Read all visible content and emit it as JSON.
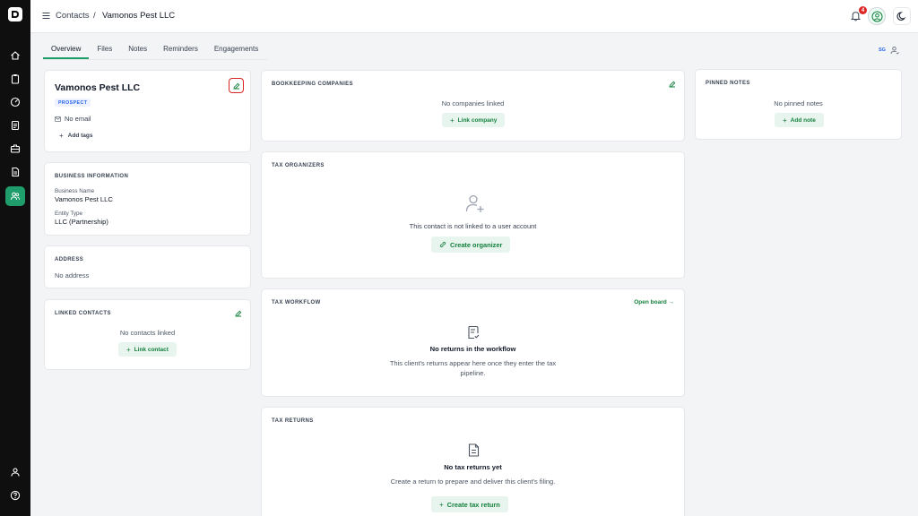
{
  "breadcrumb": {
    "parent": "Contacts",
    "separator": "/",
    "current": "Vamonos Pest LLC"
  },
  "notifications": {
    "count": "4"
  },
  "tabs": [
    {
      "label": "Overview",
      "active": true
    },
    {
      "label": "Files",
      "active": false
    },
    {
      "label": "Notes",
      "active": false
    },
    {
      "label": "Reminders",
      "active": false
    },
    {
      "label": "Engagements",
      "active": false
    }
  ],
  "presence": {
    "initials": "SG"
  },
  "contact": {
    "name": "Vamonos Pest LLC",
    "status": "PROSPECT",
    "email": "No email",
    "add_tags": "Add tags"
  },
  "business_info": {
    "title": "BUSINESS INFORMATION",
    "business_name_label": "Business Name",
    "business_name": "Vamonos Pest LLC",
    "entity_type_label": "Entity Type",
    "entity_type": "LLC (Partnership)"
  },
  "address": {
    "title": "ADDRESS",
    "value": "No address"
  },
  "linked_contacts": {
    "title": "LINKED CONTACTS",
    "empty": "No contacts linked",
    "button": "Link contact"
  },
  "bookkeeping": {
    "title": "BOOKKEEPING COMPANIES",
    "empty": "No companies linked",
    "button": "Link company"
  },
  "tax_organizers": {
    "title": "TAX ORGANIZERS",
    "message": "This contact is not linked to a user account",
    "button": "Create organizer"
  },
  "tax_workflow": {
    "title": "TAX WORKFLOW",
    "link": "Open board →",
    "heading": "No returns in the workflow",
    "line1": "This client's returns appear here once they enter the tax",
    "line2": "pipeline."
  },
  "tax_returns": {
    "title": "TAX RETURNS",
    "heading": "No tax returns yet",
    "message": "Create a return to prepare and deliver this client's filing.",
    "button": "Create tax return"
  },
  "pinned_notes": {
    "title": "PINNED NOTES",
    "empty": "No pinned notes",
    "button": "Add note"
  },
  "colors": {
    "accent": "#1f9d6b",
    "sidebar": "#0f0f10",
    "badge": "#dc2626",
    "highlight": "#dc2626"
  }
}
